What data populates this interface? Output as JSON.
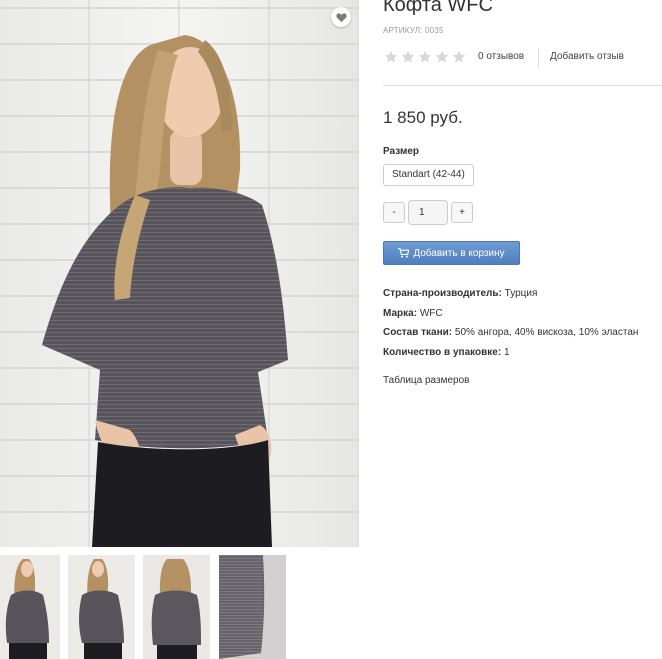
{
  "product": {
    "title": "Кофта WFC",
    "sku_label": "АРТИКУЛ:",
    "sku_value": "0035",
    "rating": 0,
    "reviews_count_label": "0 отзывов",
    "add_review_label": "Добавить отзыв",
    "price": "1 850 руб."
  },
  "options": {
    "size_label": "Размер",
    "size_value": "Standart (42-44)"
  },
  "quantity": {
    "minus_label": "-",
    "value": "1",
    "plus_label": "+"
  },
  "cart": {
    "button_label": "Добавить в корзину",
    "icon": "cart-icon"
  },
  "attributes": [
    {
      "name": "Страна-производитель:",
      "value": "Турция"
    },
    {
      "name": "Марка:",
      "value": "WFC"
    },
    {
      "name": "Состав ткани:",
      "value": "50% ангора, 40% вискоза, 10% эластан"
    },
    {
      "name": "Количество в упаковке:",
      "value": "1"
    }
  ],
  "size_table_label": "Таблица размеров",
  "colors": {
    "accent_button": "#5b89c7",
    "star_empty": "#d8d8d8",
    "sweater": "#55535a",
    "jeans": "#1c1c1f",
    "hair": "#b49466"
  }
}
